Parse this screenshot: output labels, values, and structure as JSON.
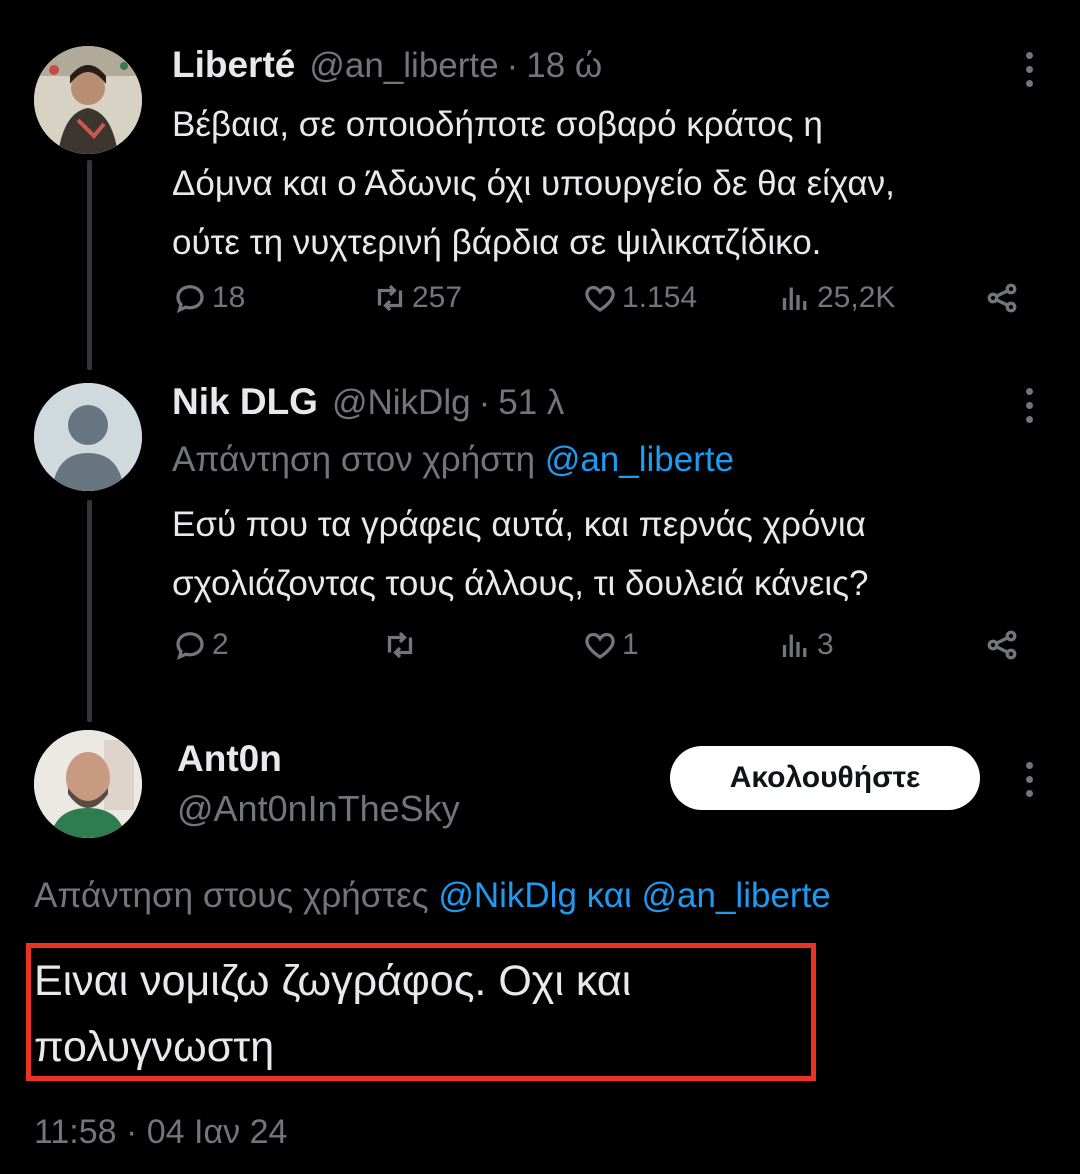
{
  "tweets": [
    {
      "name": "Liberté",
      "handle": "@an_liberte",
      "sep": "·",
      "time": "18 ώ",
      "lines": [
        "Βέβαια, σε οποιοδήποτε σοβαρό κράτος η",
        "Δόμνα και ο Άδωνις όχι υπουργείο δε θα είχαν,",
        "ούτε τη νυχτερινή βάρδια σε ψιλικατζίδικο."
      ],
      "replies": "18",
      "retweets": "257",
      "likes": "1.154",
      "views": "25,2K"
    },
    {
      "name": "Nik DLG",
      "handle": "@NikDlg",
      "sep": "·",
      "time": "51 λ",
      "reply_prefix": "Απάντηση στον χρήστη",
      "reply_mention": "@an_liberte",
      "lines": [
        "Εσύ που τα γράφεις αυτά, και περνάς χρόνια",
        "σχολιάζοντας τους άλλους, τι δουλειά κάνεις?"
      ],
      "replies": "2",
      "retweets": "",
      "likes": "1",
      "views": "3"
    }
  ],
  "main": {
    "name": "Ant0n",
    "handle": "@Ant0nInTheSky",
    "follow_label": "Ακολουθήστε",
    "reply_prefix": "Απάντηση στους χρήστες",
    "mention1": "@NikDlg",
    "conj": "και",
    "mention2": "@an_liberte",
    "lines": [
      "Ειναι νομιζω ζωγράφος. Οχι και",
      "πολυγνωστη"
    ],
    "timestamp": "11:58 · 04 Ιαν 24"
  },
  "colors": {
    "accent": "#1d9bf0",
    "muted": "#71767b",
    "highlight": "#ea3323"
  }
}
